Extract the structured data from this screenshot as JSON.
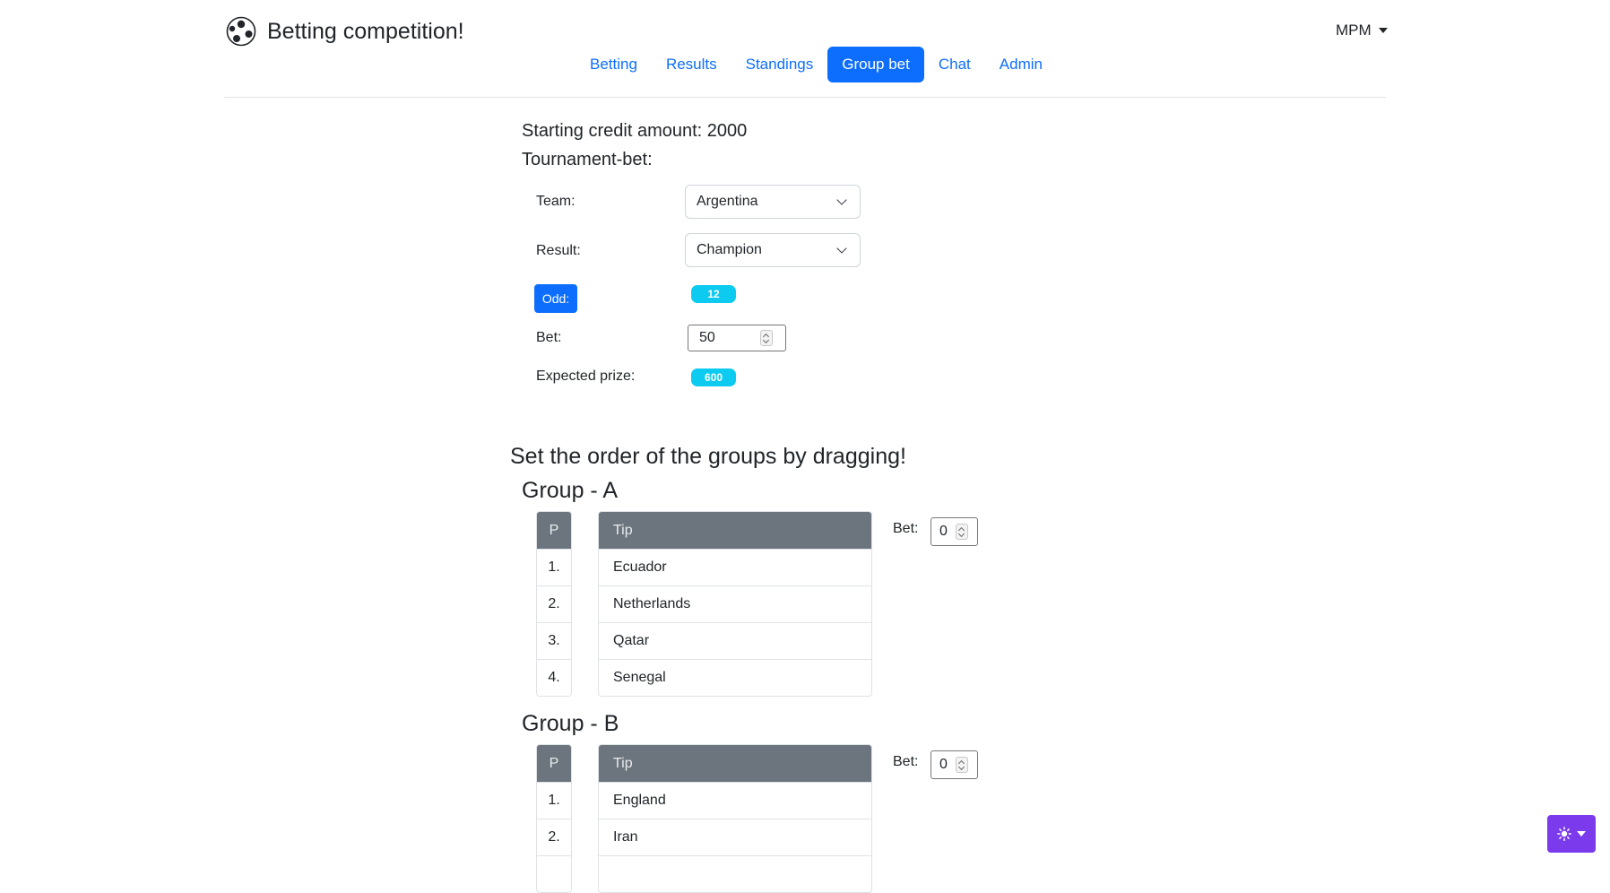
{
  "header": {
    "title": "Betting competition!",
    "user": "MPM"
  },
  "nav": {
    "items": [
      {
        "label": "Betting"
      },
      {
        "label": "Results"
      },
      {
        "label": "Standings"
      },
      {
        "label": "Group bet",
        "active": true
      },
      {
        "label": "Chat"
      },
      {
        "label": "Admin"
      }
    ]
  },
  "tournament": {
    "starting_credit": "Starting credit amount: 2000",
    "section_label": "Tournament-bet:",
    "team_label": "Team:",
    "team_value": "Argentina",
    "result_label": "Result:",
    "result_value": "Champion",
    "odd_button": "Odd:",
    "odd_value": "12",
    "bet_label": "Bet:",
    "bet_value": "50",
    "prize_label": "Expected prize:",
    "prize_value": "600"
  },
  "groups_section": {
    "title": "Set the order of the groups by dragging!",
    "pos_header": "P",
    "tip_header": "Tip",
    "bet_label": "Bet:",
    "groups": [
      {
        "title": "Group - A",
        "bet_value": "0",
        "positions": [
          "1.",
          "2.",
          "3.",
          "4."
        ],
        "teams": [
          "Ecuador",
          "Netherlands",
          "Qatar",
          "Senegal"
        ]
      },
      {
        "title": "Group - B",
        "bet_value": "0",
        "positions": [
          "1.",
          "2."
        ],
        "teams": [
          "England",
          "Iran"
        ]
      }
    ]
  },
  "colors": {
    "primary": "#0d6efd",
    "info_badge": "#0dcaf0",
    "table_header": "#6c757d",
    "theme_button": "#7c3aed"
  }
}
